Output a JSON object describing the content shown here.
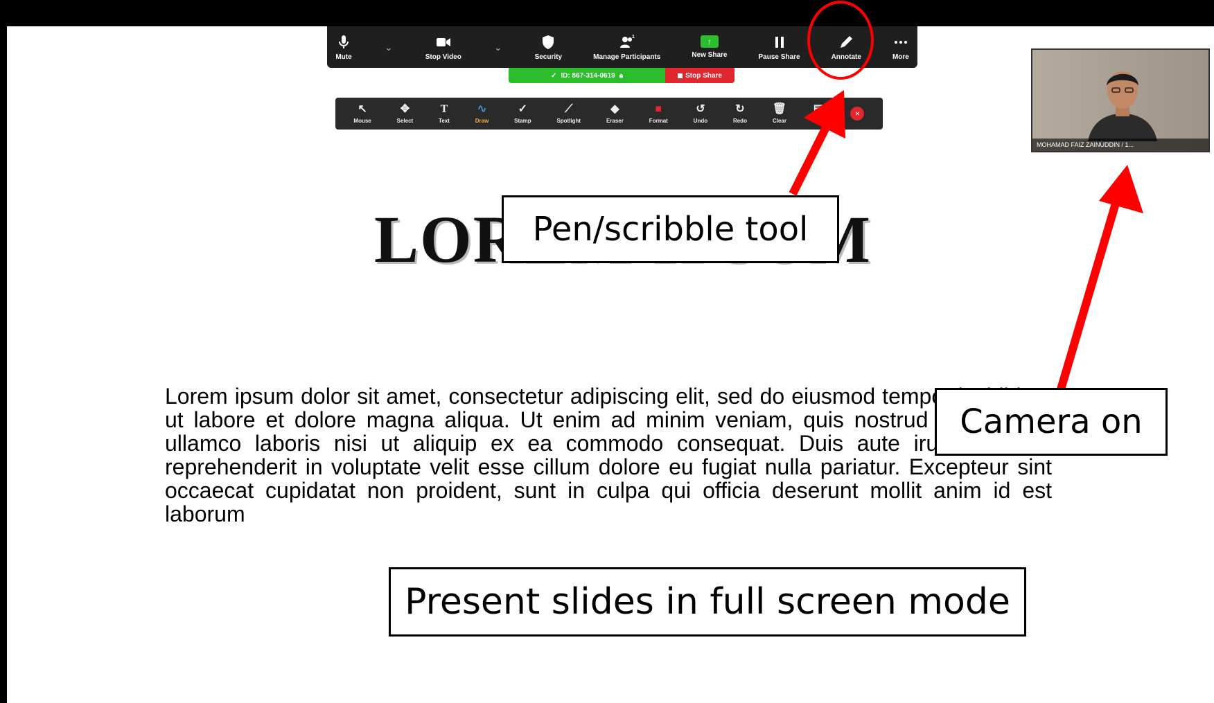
{
  "meeting_toolbar": {
    "items": [
      {
        "label": "Mute",
        "icon": "microphone-icon"
      },
      {
        "label": "Stop Video",
        "icon": "video-camera-icon"
      },
      {
        "label": "Security",
        "icon": "shield-icon"
      },
      {
        "label": "Manage Participants",
        "icon": "participants-icon",
        "count": "1"
      },
      {
        "label": "New Share",
        "icon": "share-screen-icon"
      },
      {
        "label": "Pause Share",
        "icon": "pause-icon"
      },
      {
        "label": "Annotate",
        "icon": "pen-icon"
      },
      {
        "label": "More",
        "icon": "more-icon"
      }
    ],
    "meeting_id": "ID: 867-314-0619",
    "stop_share_label": "Stop Share",
    "colors": {
      "bar": "#1f1f1f",
      "share_green": "#2bbd2b",
      "stop_red": "#e0262e"
    }
  },
  "annotation_toolbar": {
    "items": [
      {
        "label": "Mouse",
        "icon": "cursor-icon"
      },
      {
        "label": "Select",
        "icon": "move-icon"
      },
      {
        "label": "Text",
        "icon": "text-icon"
      },
      {
        "label": "Draw",
        "icon": "draw-icon"
      },
      {
        "label": "Stamp",
        "icon": "checkmark-icon"
      },
      {
        "label": "Spotlight",
        "icon": "spotlight-icon"
      },
      {
        "label": "Eraser",
        "icon": "eraser-icon"
      },
      {
        "label": "Format",
        "icon": "format-icon"
      },
      {
        "label": "Undo",
        "icon": "undo-icon"
      },
      {
        "label": "Redo",
        "icon": "redo-icon"
      },
      {
        "label": "Clear",
        "icon": "trash-icon"
      },
      {
        "label": "Save",
        "icon": "save-icon"
      }
    ]
  },
  "slide": {
    "title": "LOREM IPSUM",
    "body": "Lorem ipsum dolor sit amet, consectetur adipiscing elit, sed do eiusmod tempor incididunt ut labore et dolore magna aliqua. Ut enim ad minim veniam, quis nostrud exercitation ullamco laboris nisi ut aliquip ex ea commodo consequat. Duis aute irure dolor in reprehenderit in voluptate velit esse cillum dolore eu fugiat nulla pariatur. Excepteur sint occaecat cupidatat non proident, sunt in culpa qui officia deserunt mollit anim id est laborum"
  },
  "video_tile": {
    "participant_name": "MOHAMAD FAIZ ZAINUDDIN / 1..."
  },
  "callouts": {
    "pen_tool": "Pen/scribble tool",
    "camera": "Camera on",
    "present": "Present slides in full screen mode"
  },
  "annotation_colors": {
    "arrow": "#ff0000",
    "circle": "#ff0000"
  }
}
